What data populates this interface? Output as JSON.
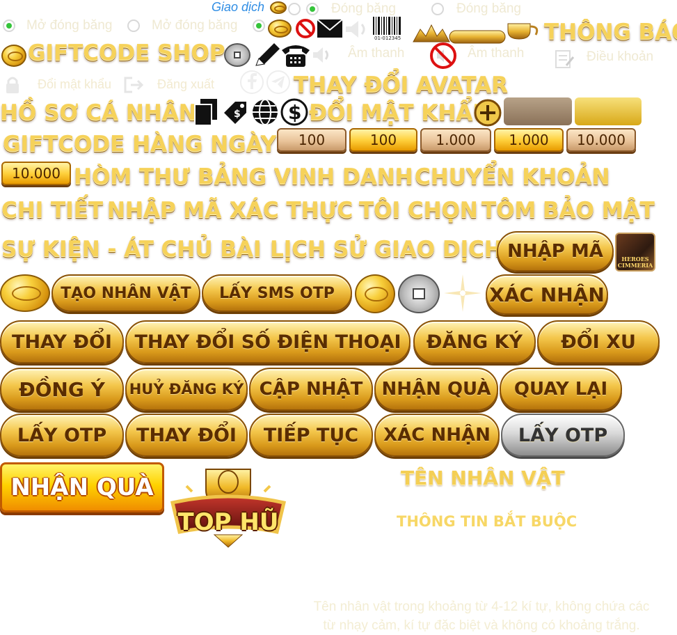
{
  "top": {
    "trade_link": "Giao dịch",
    "freeze_on": "Đóng băng",
    "freeze_on2": "Đóng băng",
    "unfreeze": "Mở đóng băng",
    "unfreeze2": "Mở đóng băng",
    "notice_title": "THÔNG BÁO",
    "barcode_text": "01-012345"
  },
  "row2": {
    "shop_title": "GIFTCODE SHOP",
    "sound1": "Âm thanh",
    "sound2": "Âm thanh",
    "terms": "Điều khoản"
  },
  "row3": {
    "change_password": "Đổi mật khẩu",
    "logout": "Đăng xuất",
    "change_avatar": "THAY ĐỔI AVATAR"
  },
  "row4": {
    "profile": "HỒ SƠ CÁ NHÂN",
    "change_password_title": "ĐỔI MẬT KHẨU"
  },
  "giftcode": {
    "title": "GIFTCODE HÀNG NGÀY",
    "chips": [
      "100",
      "100",
      "1.000",
      "1.000",
      "10.000"
    ],
    "chip_extra": "10.000"
  },
  "titles": {
    "mailbox": "HÒM THƯ",
    "leaderboard": "BẢNG VINH DANH",
    "transfer": "CHUYỂN KHOẢN",
    "detail": "CHI TIẾT",
    "enter_code": "NHẬP MÃ",
    "verify": "XÁC THỰC",
    "i_choose": "TÔI CHỌN",
    "shrimp": "TÔM",
    "security": "BẢO MẬT",
    "event": "SỰ KIỆN - ÁT CHỦ BÀI",
    "history": "LỊCH SỬ GIAO DỊCH"
  },
  "game_logo_text": "HEROES CIMMERIA",
  "buttons": {
    "enter_code": "NHẬP MÃ",
    "create_character": "TẠO NHÂN VẬT",
    "get_sms_otp": "LẤY SMS OTP",
    "confirm": "XÁC NHẬN",
    "change": "THAY ĐỔI",
    "change_phone": "THAY ĐỔI SỐ ĐIỆN THOẠI",
    "register": "ĐĂNG KÝ",
    "exchange_coin": "ĐỔI XU",
    "agree": "ĐỒNG Ý",
    "unregister": "HUỶ ĐĂNG KÝ",
    "update": "CẬP NHẬT",
    "receive_gift": "NHẬN QUÀ",
    "back": "QUAY LẠI",
    "get_otp": "LẤY OTP",
    "change2": "THAY ĐỔI",
    "continue": "TIẾP TỤC",
    "confirm2": "XÁC NHẬN",
    "get_otp_disabled": "LẤY OTP",
    "receive_gift_big": "NHẬN QUÀ"
  },
  "jackpot": {
    "label": "TOP HŨ"
  },
  "form": {
    "character_name": "TÊN NHÂN VẬT",
    "required_info": "THÔNG TIN BẮT BUỘC",
    "hint_line1": "Tên nhân vật trong khoảng từ 4-12 kí tự, không chứa các",
    "hint_line2": "từ nhạy cảm, kí tự đặc biệt và không có khoảng trắng."
  },
  "colors": {
    "gold": "#f6d25a",
    "button_text": "#5a2d02",
    "radio_on": "#35c43a",
    "link_blue": "#2f8de4"
  }
}
